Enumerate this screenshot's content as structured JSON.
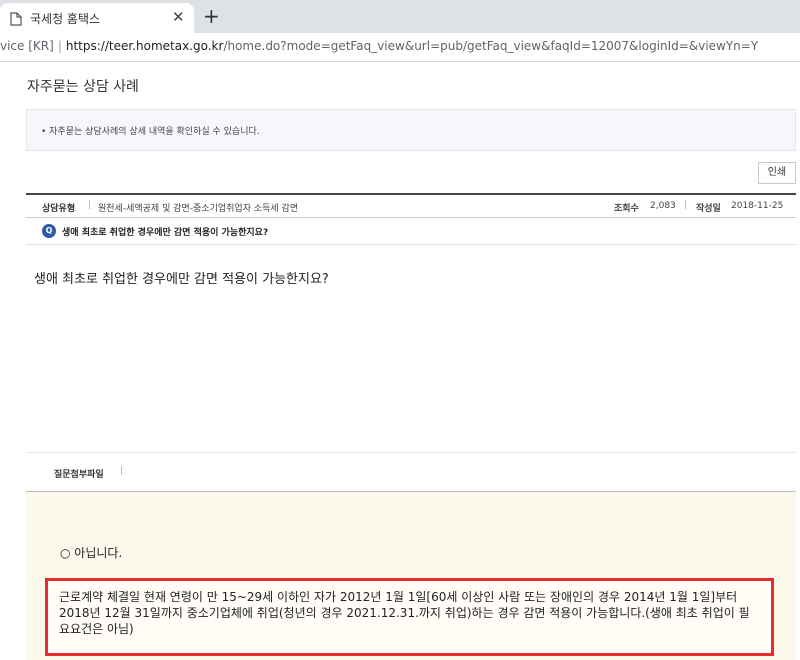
{
  "browser": {
    "tab_title": "국세청 홈택스",
    "tab_close": "✕",
    "new_tab": "+",
    "site_label": "vice [KR]",
    "separator": "|",
    "url_host": "https://teer.hometax.go.kr",
    "url_rest": "/home.do?mode=getFaq_view&url=pub/getFaq_view&faqId=12007&loginId=&viewYn=Y"
  },
  "page": {
    "title": "자주묻는 상담 사례",
    "notice": "• 자주묻는 상담사례의 상세 내역을 확인하실 수 있습니다.",
    "print_label": "인쇄"
  },
  "info": {
    "category_label": "상담유형",
    "category_value": "원천세-세액공제 및 감면-중소기업취업자 소득세 감면",
    "views_label": "조회수",
    "views_value": "2,083",
    "date_label": "작성일",
    "date_value": "2018-11-25",
    "bar": "|"
  },
  "question": {
    "badge": "Q",
    "title": "생애 최초로 취업한 경우에만 감면 적용이 가능한지요?",
    "body": "생애 최초로 취업한 경우에만 감면 적용이 가능한지요?"
  },
  "attachment": {
    "label": "질문첨부파일",
    "bar": "|"
  },
  "answer": {
    "head": "○ 아닙니다.",
    "text": "근로계약 체결일 현재 연령이 만 15~29세 이하인 자가 2012년 1월 1일[60세 이상인 사람 또는 장애인의 경우 2014년 1월 1일]부터 2018년 12월 31일까지 중소기업체에 취업(청년의 경우 2021.12.31.까지 취업)하는 경우 감면 적용이 가능합니다.(생애 최초 취업이 필요요건은 아님)"
  },
  "colors": {
    "highlight_border": "#e52d2d",
    "answer_background": "#fdf8ec",
    "q_badge": "#2d5aa8"
  }
}
